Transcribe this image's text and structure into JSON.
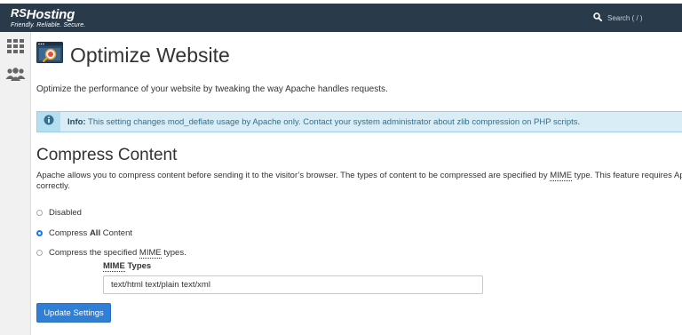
{
  "header": {
    "logo_prefix": "RS",
    "logo_name": "Hosting",
    "tagline": "Friendly. Reliable. Secure.",
    "search_label": "Search ( / )"
  },
  "sidebar": {
    "items": [
      {
        "icon": "grid-icon"
      },
      {
        "icon": "users-icon"
      }
    ]
  },
  "page": {
    "title": "Optimize Website",
    "description": "Optimize the performance of your website by tweaking the way Apache handles requests."
  },
  "info": {
    "label": "Info:",
    "text": " This setting changes mod_deflate usage by Apache only. Contact your system administrator about zlib compression on PHP scripts."
  },
  "compress": {
    "title": "Compress Content",
    "desc_part1": "Apache allows you to compress content before sending it to the visitor’s browser. The types of content to be compressed are specified by ",
    "desc_abbr": "MIME",
    "desc_part2": " type. This feature requires Apa",
    "desc_line2": "correctly.",
    "options": [
      {
        "label_pre": "Disabled",
        "label_bold": "",
        "label_abbr": "",
        "label_post": "",
        "checked": false
      },
      {
        "label_pre": "Compress ",
        "label_bold": "All",
        "label_abbr": "",
        "label_post": " Content",
        "checked": true
      },
      {
        "label_pre": "Compress the specified ",
        "label_bold": "",
        "label_abbr": "MIME",
        "label_post": " types.",
        "checked": false
      }
    ],
    "mime_label_abbr": "MIME",
    "mime_label_rest": " Types",
    "mime_value": "text/html text/plain text/xml",
    "update_button": "Update Settings"
  },
  "colors": {
    "header_bg": "#293a4a",
    "accent": "#2f7fd6",
    "info_bg": "#d9edf7",
    "info_text": "#31708f"
  }
}
